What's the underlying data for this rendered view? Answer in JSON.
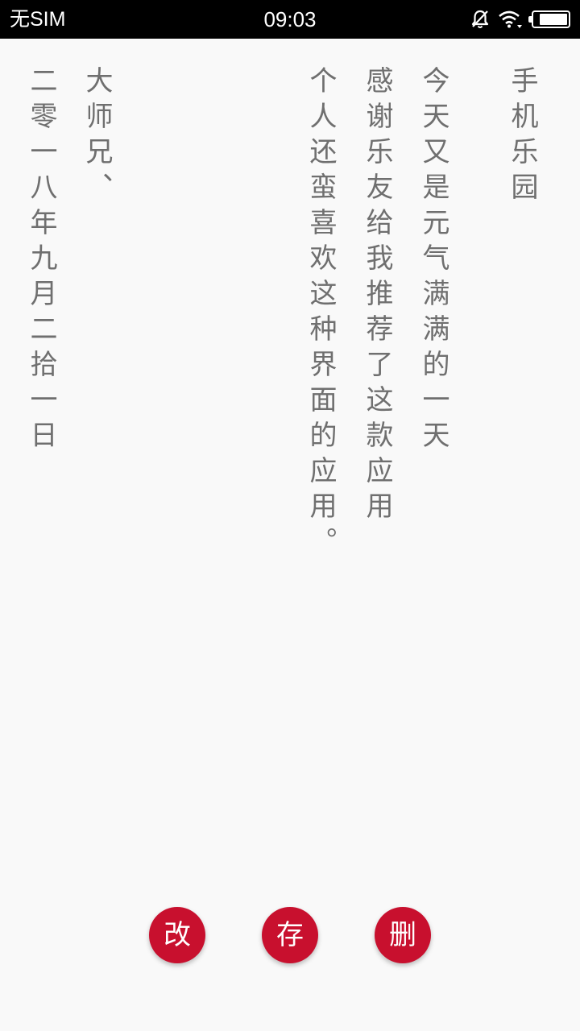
{
  "status_bar": {
    "carrier": "无SIM",
    "time": "09:03",
    "icons": [
      "mute-bell-icon",
      "wifi-icon",
      "battery-icon"
    ],
    "battery_level": 0.85
  },
  "note": {
    "title": "手机乐园",
    "body": [
      "今天又是元气满满的一天",
      "感谢乐友给我推荐了这款应用",
      "个人还蛮喜欢这种界面的应用。"
    ],
    "signature": "大师兄、",
    "date": "二零一八年九月二拾一日"
  },
  "actions": {
    "edit_label": "改",
    "save_label": "存",
    "delete_label": "删"
  },
  "colors": {
    "accent": "#c8102e",
    "text": "#6f6f6f",
    "background": "#f9f9f9",
    "status_bar": "#000000"
  }
}
